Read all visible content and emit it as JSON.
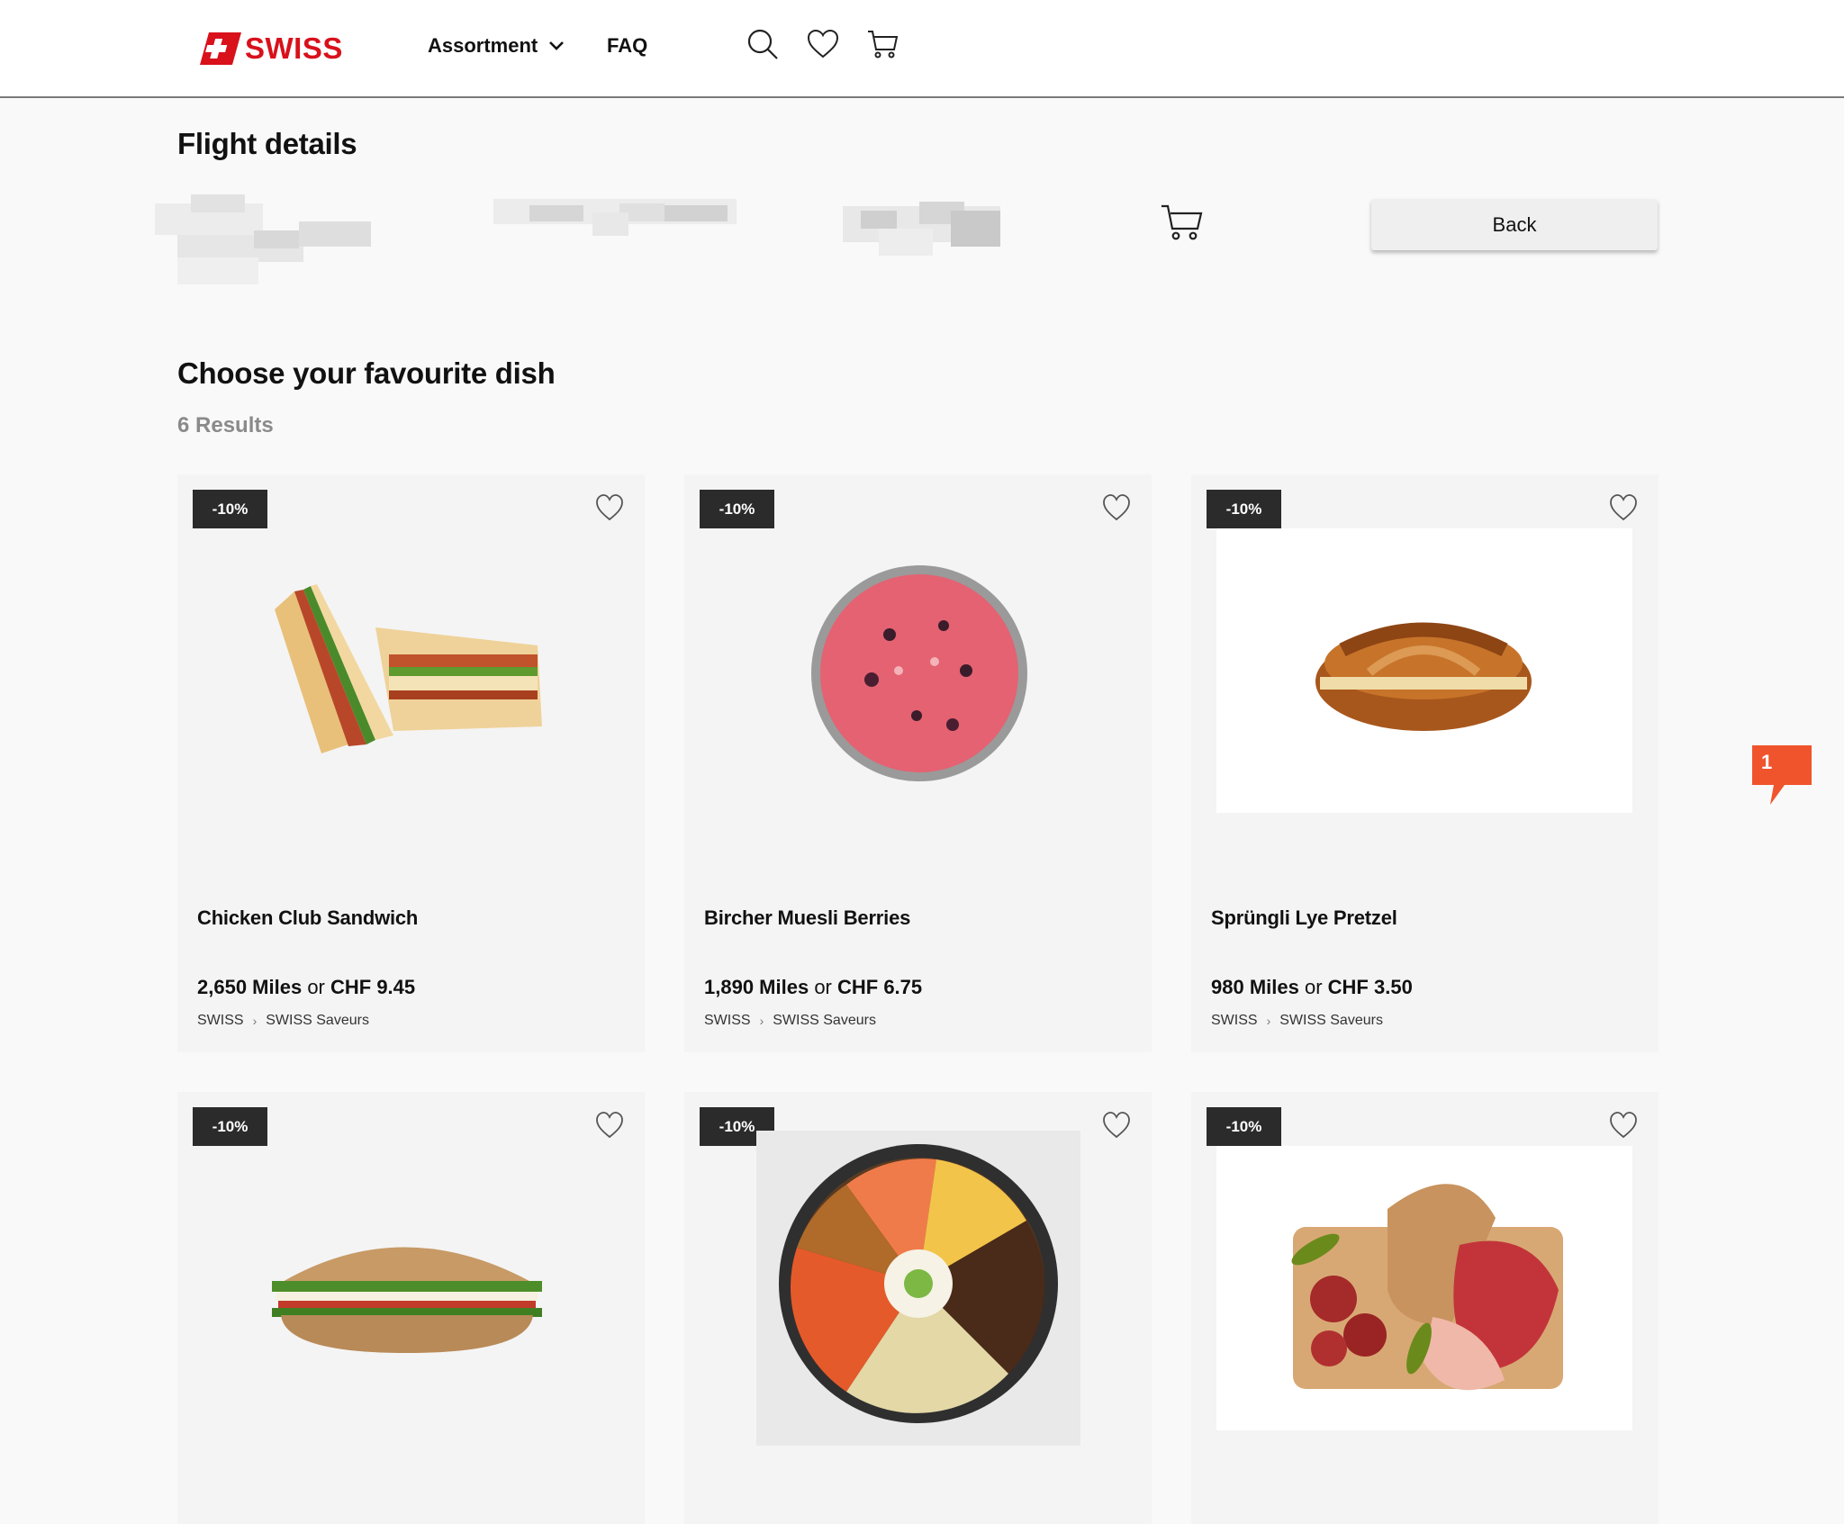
{
  "header": {
    "logo_text": "SWISS",
    "nav": [
      {
        "label": "Assortment"
      },
      {
        "label": "FAQ"
      }
    ]
  },
  "flight": {
    "title": "Flight details",
    "back_label": "Back"
  },
  "listing": {
    "title": "Choose your favourite dish",
    "results_label": "6 Results"
  },
  "products": [
    {
      "badge": "-10%",
      "name": "Chicken Club Sandwich",
      "miles": "2,650 Miles",
      "or": "or",
      "chf": "CHF 9.45",
      "crumb1": "SWISS",
      "crumb2": "SWISS Saveurs"
    },
    {
      "badge": "-10%",
      "name": "Bircher Muesli Berries",
      "miles": "1,890 Miles",
      "or": "or",
      "chf": "CHF 6.75",
      "crumb1": "SWISS",
      "crumb2": "SWISS Saveurs"
    },
    {
      "badge": "-10%",
      "name": "Sprüngli Lye Pretzel",
      "miles": "980 Miles",
      "or": "or",
      "chf": "CHF 3.50",
      "crumb1": "SWISS",
      "crumb2": "SWISS Saveurs"
    },
    {
      "badge": "-10%"
    },
    {
      "badge": "-10%"
    },
    {
      "badge": "-10%"
    }
  ],
  "feedback": {
    "count": "1"
  },
  "colors": {
    "brand_red": "#d8111b",
    "feedback_orange": "#f0542d",
    "badge_bg": "#2b2b2b"
  }
}
